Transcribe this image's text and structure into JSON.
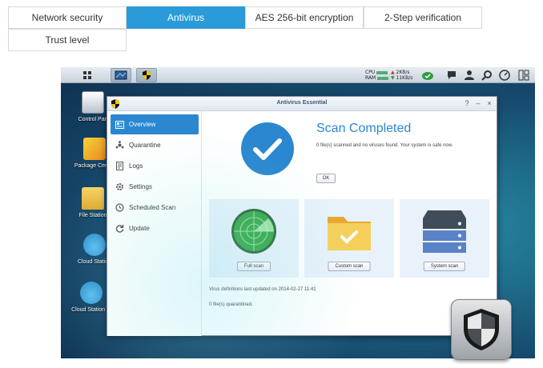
{
  "tabs": [
    {
      "label": "Network security",
      "active": false
    },
    {
      "label": "Antivirus",
      "active": true
    },
    {
      "label": "AES 256-bit encryption",
      "active": false
    },
    {
      "label": "2-Step verification",
      "active": false
    },
    {
      "label": "Trust level",
      "active": false
    }
  ],
  "taskbar": {
    "cpu_label": "CPU",
    "ram_label": "RAM",
    "upload": "2KB/s",
    "download": "11KB/s"
  },
  "desktop": {
    "icons": [
      {
        "label": "Control Pan"
      },
      {
        "label": "Package Center"
      },
      {
        "label": "File Station"
      },
      {
        "label": "Cloud Station"
      },
      {
        "label": "Cloud Station ..."
      }
    ]
  },
  "window": {
    "title": "Antivirus Essential",
    "controls": {
      "help": "?",
      "minimize": "–",
      "close": "×"
    },
    "sidebar": [
      {
        "label": "Overview",
        "icon": "overview-icon",
        "active": true
      },
      {
        "label": "Quarantine",
        "icon": "quarantine-icon",
        "active": false
      },
      {
        "label": "Logs",
        "icon": "logs-icon",
        "active": false
      },
      {
        "label": "Settings",
        "icon": "settings-icon",
        "active": false
      },
      {
        "label": "Scheduled Scan",
        "icon": "scheduled-scan-icon",
        "active": false
      },
      {
        "label": "Update",
        "icon": "update-icon",
        "active": false
      }
    ],
    "status": {
      "headline": "Scan Completed",
      "detail": "0 file(s) scanned and no viruses found. Your system is safe now.",
      "ok_label": "OK"
    },
    "scan_cards": [
      {
        "button": "Full scan",
        "icon": "radar-icon"
      },
      {
        "button": "Custom scan",
        "icon": "folder-check-icon"
      },
      {
        "button": "System scan",
        "icon": "server-stack-icon"
      }
    ],
    "footer": {
      "definitions": "Virus definitions last updated on 2014-02-27 11:41",
      "quarantined": "0 file(s) quarantined."
    }
  },
  "colors": {
    "accent": "#2a87d0",
    "tab_active": "#2a9bd8"
  }
}
